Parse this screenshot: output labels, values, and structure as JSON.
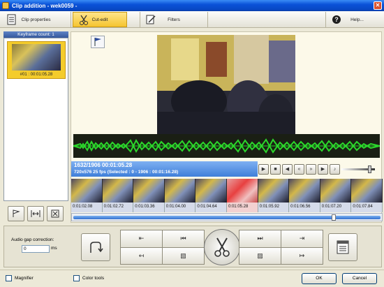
{
  "window": {
    "title": "Clip addition - wek0059 -"
  },
  "toolbar": {
    "clip_properties": "Clip properties",
    "cut_edit": "Cut-edit",
    "filters": "Filters",
    "help": "Help..."
  },
  "keyframes": {
    "header": "Keyframe count: 1",
    "items": [
      {
        "label": "#01 : 00:01:05.28"
      }
    ]
  },
  "info": {
    "position": "1632/1906  00:01:05.28",
    "details": "720x576 25  fps  (Selected : 0 - 1906 : 00:01:16.28)"
  },
  "timeline": {
    "ticks": [
      "0:01:02.08",
      "0:01:02.72",
      "0:01:03.36",
      "0:01:04.00",
      "0:01:04.64",
      "0:01:05.28",
      "0:01:05.92",
      "0:01:06.56",
      "0:01:07.20",
      "0:01:07.84"
    ]
  },
  "bottom": {
    "audio_gap_label": "Audio gap correction:",
    "audio_gap_value": "0",
    "audio_gap_unit": "ms"
  },
  "footer": {
    "magnifier": "Magnifier",
    "color_tools": "Color tools",
    "ok": "OK",
    "cancel": "Cancel"
  },
  "colors": {
    "active_tab": "#f5c430",
    "waveform": "#2bd62b",
    "selection": "#3f7fd9"
  }
}
